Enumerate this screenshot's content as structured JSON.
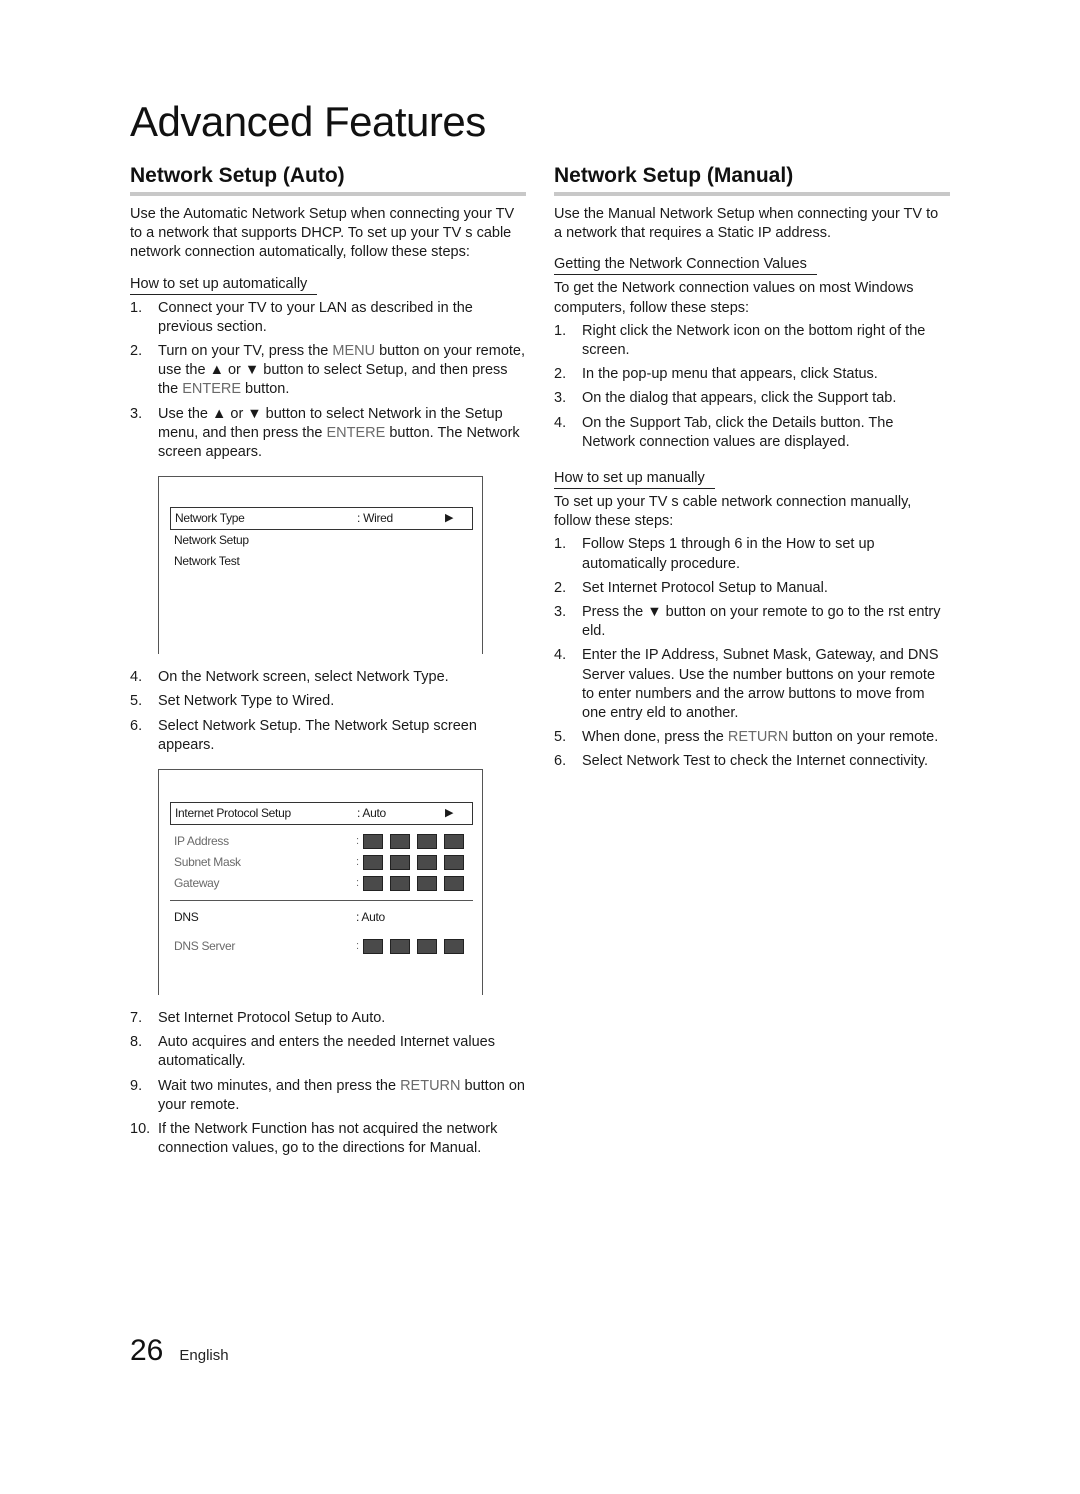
{
  "page": {
    "title": "Advanced Features",
    "page_number": "26",
    "language": "English"
  },
  "auto": {
    "title": "Network Setup (Auto)",
    "intro": "Use the Automatic Network Setup when connecting your TV to a network that supports DHCP. To set up your TV s cable network connection automatically, follow these steps:",
    "subhead": "How to set up automatically",
    "steps_a": [
      {
        "num": "1.",
        "parts": [
          {
            "t": "Connect your TV to your LAN as described in the previous section."
          }
        ]
      },
      {
        "num": "2.",
        "parts": [
          {
            "t": "Turn on your TV, press the "
          },
          {
            "t": "MENU",
            "g": true
          },
          {
            "t": " button on your remote, use the ▲ or ▼ button to select Setup, and then press the "
          },
          {
            "t": "ENTERE",
            "g": true
          },
          {
            "t": "    button."
          }
        ]
      },
      {
        "num": "3.",
        "parts": [
          {
            "t": "Use the ▲ or ▼ button to select Network in the Setup menu, and then press the "
          },
          {
            "t": "ENTERE",
            "g": true
          },
          {
            "t": "    button. The Network screen appears."
          }
        ]
      }
    ],
    "screen1": {
      "rows": [
        {
          "label": "Network Type",
          "value": ": Wired",
          "arrow": "▶",
          "selected": true
        },
        {
          "label": "Network Setup"
        },
        {
          "label": "Network Test"
        }
      ]
    },
    "steps_b": [
      {
        "num": "4.",
        "parts": [
          {
            "t": "On the Network screen, select Network Type."
          }
        ]
      },
      {
        "num": "5.",
        "parts": [
          {
            "t": "Set Network Type to Wired."
          }
        ]
      },
      {
        "num": "6.",
        "parts": [
          {
            "t": "Select Network Setup. The Network Setup screen appears."
          }
        ]
      }
    ],
    "screen2": {
      "header": {
        "label": "Internet Protocol Setup",
        "value": ": Auto",
        "arrow": "▶"
      },
      "fields": [
        {
          "label": "IP Address",
          "colon": ":"
        },
        {
          "label": "Subnet Mask",
          "colon": ":"
        },
        {
          "label": "Gateway",
          "colon": ":"
        }
      ],
      "dns": {
        "label": "DNS",
        "value": ": Auto"
      },
      "dns_server": {
        "label": "DNS Server",
        "colon": ":"
      }
    },
    "steps_c": [
      {
        "num": "7.",
        "parts": [
          {
            "t": "Set Internet Protocol Setup to Auto."
          }
        ]
      },
      {
        "num": "8.",
        "parts": [
          {
            "t": "Auto acquires and enters the needed Internet values automatically."
          }
        ]
      },
      {
        "num": "9.",
        "parts": [
          {
            "t": "Wait two minutes, and then press the  "
          },
          {
            "t": "RETURN",
            "g": true
          },
          {
            "t": " button on your remote."
          }
        ]
      },
      {
        "num": "10.",
        "parts": [
          {
            "t": "If the Network Function has not acquired the network connection values, go to the directions for Manual."
          }
        ]
      }
    ]
  },
  "manual": {
    "title": "Network Setup (Manual)",
    "intro": "Use the Manual Network Setup when connecting your TV to a network that requires a Static IP address.",
    "subhead1": "Getting the Network Connection Values",
    "text1": "To get the Network connection values on most Windows computers, follow these steps:",
    "steps1": [
      {
        "num": "1.",
        "parts": [
          {
            "t": "Right click the Network icon on the bottom right of the screen."
          }
        ]
      },
      {
        "num": "2.",
        "parts": [
          {
            "t": "In the pop-up menu that appears, click Status."
          }
        ]
      },
      {
        "num": "3.",
        "parts": [
          {
            "t": "On the dialog that appears, click the Support tab."
          }
        ]
      },
      {
        "num": "4.",
        "parts": [
          {
            "t": "On the Support Tab, click the Details button. The Network connection values are displayed."
          }
        ]
      }
    ],
    "subhead2": "How to set up manually",
    "text2": "To set up your TV s cable network connection manually, follow these steps:",
    "steps2": [
      {
        "num": "1.",
        "parts": [
          {
            "t": "Follow Steps 1 through 6 in the  How to set up automatically  procedure."
          }
        ]
      },
      {
        "num": "2.",
        "parts": [
          {
            "t": "Set Internet Protocol Setup to Manual."
          }
        ]
      },
      {
        "num": "3.",
        "parts": [
          {
            "t": "Press the ▼ button on your remote to go to the  rst entry  eld."
          }
        ]
      },
      {
        "num": "4.",
        "parts": [
          {
            "t": "Enter the IP Address, Subnet Mask, Gateway, and DNS Server values. Use the number buttons on your remote to enter numbers and the arrow buttons to move from one entry  eld to another."
          }
        ]
      },
      {
        "num": "5.",
        "parts": [
          {
            "t": "When done, press the "
          },
          {
            "t": "RETURN",
            "g": true
          },
          {
            "t": " button on your remote."
          }
        ]
      },
      {
        "num": "6.",
        "parts": [
          {
            "t": "Select Network Test to check the Internet connectivity."
          }
        ]
      }
    ]
  }
}
